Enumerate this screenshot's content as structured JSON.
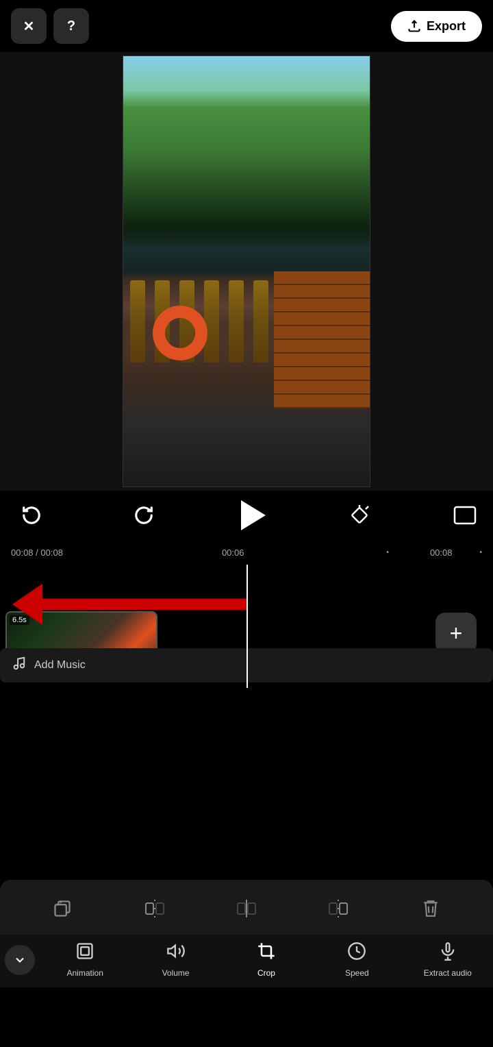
{
  "topBar": {
    "closeLabel": "×",
    "helpLabel": "?",
    "exportLabel": "Export"
  },
  "timeDisplay": {
    "current": "00:08",
    "total": "00:08",
    "marker1": "00:06",
    "marker2": "00:08"
  },
  "clip": {
    "duration": "6.5s"
  },
  "timeline": {
    "addMusicLabel": "Add Music",
    "addClipLabel": "+"
  },
  "toolbarIcons": [
    {
      "name": "copy-clip",
      "label": "copy"
    },
    {
      "name": "split",
      "label": "split"
    },
    {
      "name": "trim",
      "label": "trim"
    },
    {
      "name": "split-right",
      "label": "split-right"
    },
    {
      "name": "delete",
      "label": "delete"
    }
  ],
  "bottomNav": {
    "collapseIcon": "chevron-down",
    "items": [
      {
        "id": "animation",
        "label": "Animation",
        "icon": "animation"
      },
      {
        "id": "volume",
        "label": "Volume",
        "icon": "volume"
      },
      {
        "id": "crop",
        "label": "Crop",
        "icon": "crop",
        "active": true
      },
      {
        "id": "speed",
        "label": "Speed",
        "icon": "speed"
      },
      {
        "id": "extract-audio",
        "label": "Extract audio",
        "icon": "extract-audio"
      }
    ]
  }
}
